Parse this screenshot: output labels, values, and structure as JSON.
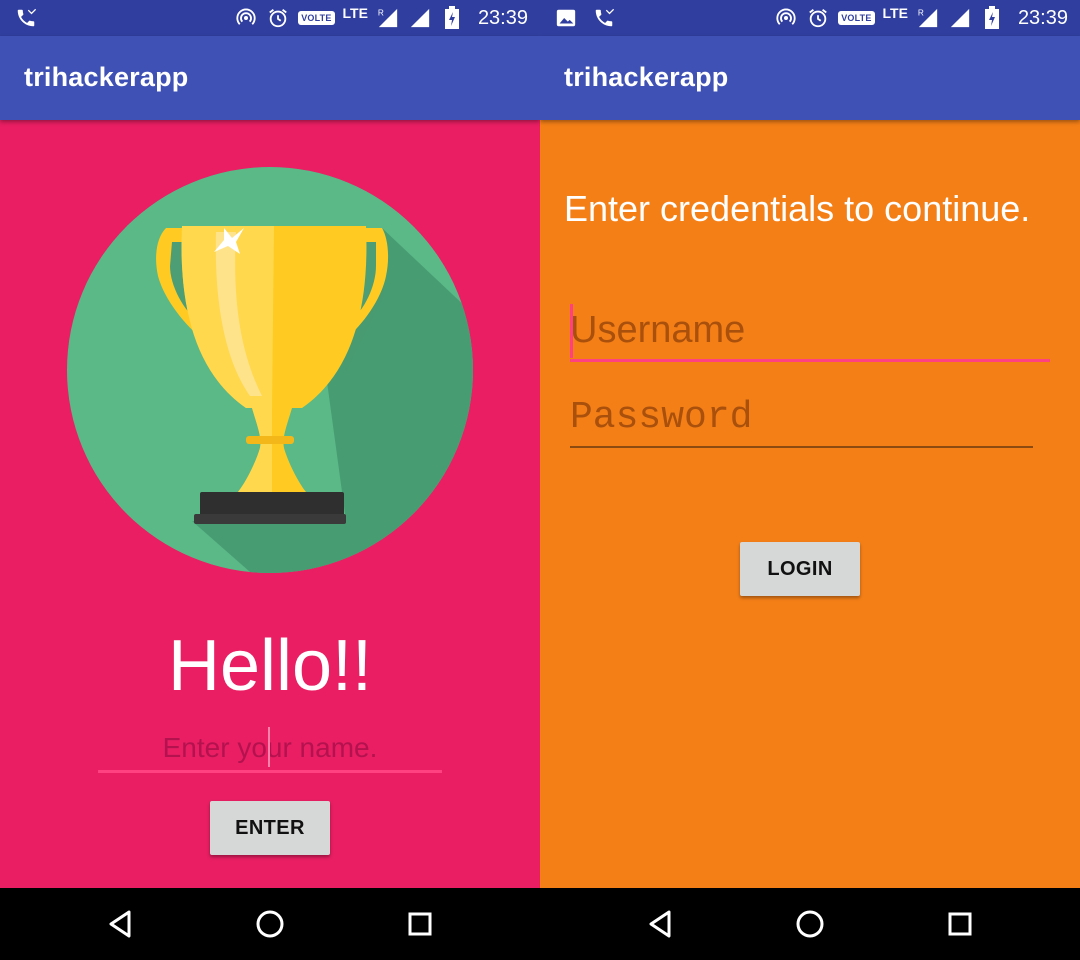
{
  "status_bar": {
    "time": "23:39",
    "volte_label": "VOLTE",
    "network_label": "LTE",
    "roaming_label": "R"
  },
  "left_screen": {
    "app_title": "trihackerapp",
    "greeting": "Hello!!",
    "name_placeholder": "Enter your name.",
    "enter_button": "ENTER"
  },
  "right_screen": {
    "app_title": "trihackerapp",
    "prompt": "Enter credentials to continue.",
    "username_placeholder": "Username",
    "password_placeholder": "Password",
    "login_button": "LOGIN"
  },
  "colors": {
    "status_bar": "#303F9F",
    "app_bar": "#3F51B5",
    "left_background": "#E91E63",
    "right_background": "#F47F17",
    "accent": "#FF4081",
    "trophy_circle": "#5AB987",
    "trophy_gold": "#FFCB22",
    "button": "#D6D7D7"
  },
  "icons": {
    "status_left_1": "missed-call-icon",
    "status_left_2": "image-icon",
    "status_right": [
      "hotspot-icon",
      "alarm-icon",
      "signal-icon",
      "battery-icon"
    ],
    "illustration": "trophy-icon",
    "nav": [
      "back-icon",
      "home-icon",
      "recents-icon"
    ]
  }
}
